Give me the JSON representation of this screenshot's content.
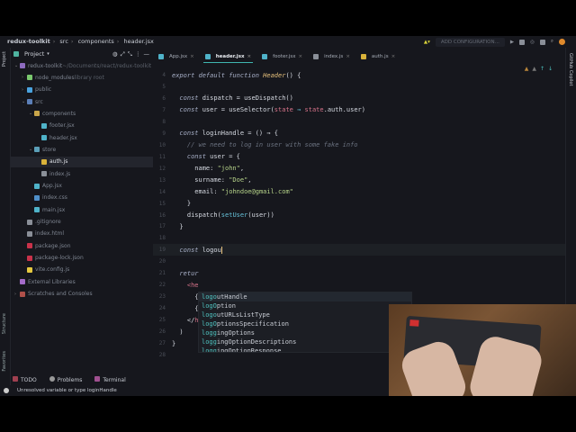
{
  "breadcrumb": [
    "redux-toolkit",
    "src",
    "components",
    "header.jsx"
  ],
  "toolbar": {
    "add_configuration": "ADD CONFIGURATION..."
  },
  "left_strip": {
    "project": "Project",
    "structure": "Structure",
    "favorites": "Favorites"
  },
  "right_strip": {
    "copilot": "GitHub Copilot"
  },
  "project_panel": {
    "title": "Project",
    "items": [
      {
        "label": "redux-toolkit",
        "extra": " ~/Documents/react/redux-toolkit",
        "depth": 0,
        "chev": "v",
        "color": "#8d6bbf"
      },
      {
        "label": "node_modules",
        "extra": " library root",
        "depth": 1,
        "chev": ">",
        "color": "#7bc96f"
      },
      {
        "label": "public",
        "depth": 1,
        "chev": ">",
        "color": "#4aa3df"
      },
      {
        "label": "src",
        "depth": 1,
        "chev": "v",
        "color": "#5b7fb8"
      },
      {
        "label": "components",
        "depth": 2,
        "chev": "v",
        "color": "#c9a64a"
      },
      {
        "label": "footer.jsx",
        "depth": 3,
        "color": "#4fb3c9"
      },
      {
        "label": "header.jsx",
        "depth": 3,
        "color": "#4fb3c9"
      },
      {
        "label": "store",
        "depth": 2,
        "chev": "v",
        "color": "#5b9fb8"
      },
      {
        "label": "auth.js",
        "depth": 3,
        "color": "#d9b23a",
        "selected": true
      },
      {
        "label": "index.js",
        "depth": 3,
        "color": "#8a8f98"
      },
      {
        "label": "App.jsx",
        "depth": 2,
        "color": "#4fb3c9"
      },
      {
        "label": "index.css",
        "depth": 2,
        "color": "#4f8fc9"
      },
      {
        "label": "main.jsx",
        "depth": 2,
        "color": "#4fb3c9"
      },
      {
        "label": ".gitignore",
        "depth": 1,
        "color": "#8a8f98"
      },
      {
        "label": "index.html",
        "depth": 1,
        "color": "#8a8f98"
      },
      {
        "label": "package.json",
        "depth": 1,
        "color": "#c9324a"
      },
      {
        "label": "package-lock.json",
        "depth": 1,
        "color": "#c9324a"
      },
      {
        "label": "vite.config.js",
        "depth": 1,
        "color": "#e6c940"
      },
      {
        "label": "External Libraries",
        "depth": 0,
        "color": "#a46bc9"
      },
      {
        "label": "Scratches and Consoles",
        "depth": 0,
        "chev": ">",
        "color": "#b0504a"
      }
    ]
  },
  "tabs": [
    {
      "label": "App.jsx"
    },
    {
      "label": "header.jsx",
      "active": true
    },
    {
      "label": "footer.jsx"
    },
    {
      "label": "index.js"
    },
    {
      "label": "auth.js"
    }
  ],
  "code": [
    {
      "n": "4",
      "t": [
        [
          "export default function ",
          "kw"
        ],
        [
          "Header",
          "fn"
        ],
        [
          "() {",
          "id"
        ]
      ]
    },
    {
      "n": "5",
      "t": []
    },
    {
      "n": "6",
      "t": [
        [
          "  const ",
          "kw"
        ],
        [
          "dispatch = useDispatch()",
          "id"
        ]
      ]
    },
    {
      "n": "7",
      "t": [
        [
          "  const ",
          "kw"
        ],
        [
          "user = useSelector(",
          "id"
        ],
        [
          "state",
          "prop"
        ],
        [
          " ⇒ ",
          "call"
        ],
        [
          "state",
          "prop"
        ],
        [
          ".auth.user)",
          "id"
        ]
      ]
    },
    {
      "n": "8",
      "t": []
    },
    {
      "n": "9",
      "t": [
        [
          "  const ",
          "kw"
        ],
        [
          "loginHandle = () ⇒ {",
          "id"
        ]
      ]
    },
    {
      "n": "10",
      "t": [
        [
          "    // we need to log in user with some fake info",
          "cm"
        ]
      ]
    },
    {
      "n": "11",
      "t": [
        [
          "    const ",
          "kw"
        ],
        [
          "user = {",
          "id"
        ]
      ]
    },
    {
      "n": "12",
      "t": [
        [
          "      name: ",
          "id"
        ],
        [
          "\"john\"",
          "str"
        ],
        [
          ",",
          "id"
        ]
      ]
    },
    {
      "n": "13",
      "t": [
        [
          "      surname: ",
          "id"
        ],
        [
          "\"Doe\"",
          "str"
        ],
        [
          ",",
          "id"
        ]
      ]
    },
    {
      "n": "14",
      "t": [
        [
          "      email: ",
          "id"
        ],
        [
          "\"johndoe@gmail.com\"",
          "str"
        ]
      ]
    },
    {
      "n": "15",
      "t": [
        [
          "    }",
          "id"
        ]
      ]
    },
    {
      "n": "16",
      "t": [
        [
          "    dispatch(",
          "id"
        ],
        [
          "setUser",
          "call"
        ],
        [
          "(user))",
          "id"
        ]
      ]
    },
    {
      "n": "17",
      "t": [
        [
          "  }",
          "id"
        ]
      ]
    },
    {
      "n": "18",
      "t": []
    },
    {
      "n": "19",
      "t": [
        [
          "  const ",
          "kw"
        ],
        [
          "logou",
          "id"
        ]
      ],
      "current": true
    },
    {
      "n": "20",
      "t": []
    },
    {
      "n": "21",
      "t": [
        [
          "  retur",
          "kw"
        ]
      ]
    },
    {
      "n": "22",
      "t": [
        [
          "    <he",
          "tag"
        ]
      ]
    },
    {
      "n": "23",
      "t": [
        [
          "      {",
          "id"
        ]
      ]
    },
    {
      "n": "24",
      "t": [
        [
          "      {u",
          "id"
        ]
      ]
    },
    {
      "n": "25",
      "t": [
        [
          "    </",
          "id"
        ],
        [
          "header",
          "tag"
        ],
        [
          ">",
          "id"
        ]
      ]
    },
    {
      "n": "26",
      "t": [
        [
          "  )",
          "id"
        ]
      ]
    },
    {
      "n": "27",
      "t": [
        [
          "}",
          "id"
        ]
      ]
    },
    {
      "n": "28",
      "t": []
    }
  ],
  "autocomplete": [
    {
      "match": "logo",
      "rest": "utHandle"
    },
    {
      "match": "logO",
      "rest": "ption"
    },
    {
      "match": "logo",
      "rest": "utURLsListType"
    },
    {
      "match": "logO",
      "rest": "ptionsSpecification"
    },
    {
      "match": "logg",
      "rest": "ingOptions"
    },
    {
      "match": "logg",
      "rest": "ingOptionDescriptions"
    },
    {
      "match": "logg",
      "rest": "ingOptionResponse"
    }
  ],
  "bottom_tabs": [
    "TODO",
    "Problems",
    "Terminal"
  ],
  "status": "Unresolved variable or type loginHandle"
}
